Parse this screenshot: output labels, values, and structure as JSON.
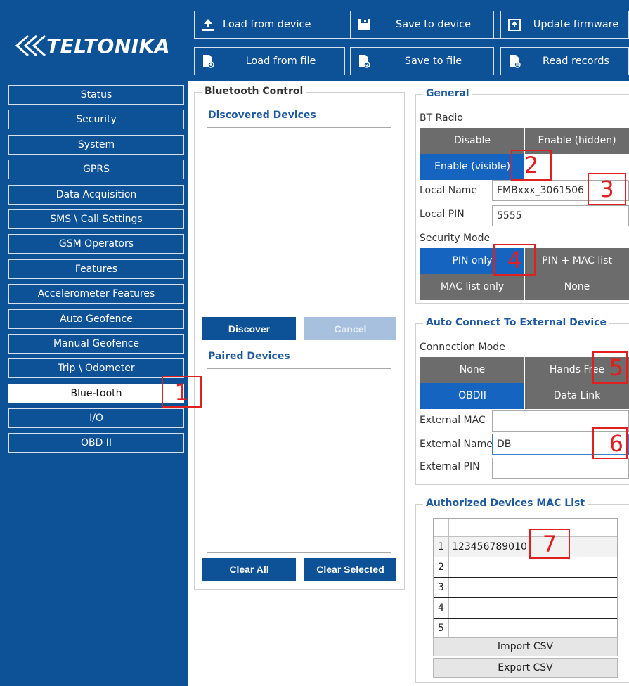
{
  "brand": {
    "name": "TELTONIKA"
  },
  "toolbar": {
    "load_from_device": "Load from device",
    "save_to_device": "Save to device",
    "update_firmware": "Update firmware",
    "load_from_file": "Load from file",
    "save_to_file": "Save to file",
    "read_records": "Read records"
  },
  "sidebar": {
    "items": [
      {
        "label": "Status"
      },
      {
        "label": "Security"
      },
      {
        "label": "System"
      },
      {
        "label": "GPRS"
      },
      {
        "label": "Data Acquisition"
      },
      {
        "label": "SMS \\ Call Settings"
      },
      {
        "label": "GSM Operators"
      },
      {
        "label": "Features"
      },
      {
        "label": "Accelerometer Features"
      },
      {
        "label": "Auto Geofence"
      },
      {
        "label": "Manual Geofence"
      },
      {
        "label": "Trip \\ Odometer"
      },
      {
        "label": "Blue-tooth"
      },
      {
        "label": "I/O"
      },
      {
        "label": "OBD II"
      }
    ],
    "active": "Blue-tooth"
  },
  "bluetooth_control": {
    "title": "Bluetooth Control",
    "discovered_title": "Discovered Devices",
    "discover_btn": "Discover",
    "cancel_btn": "Cancel",
    "paired_title": "Paired Devices",
    "clear_all_btn": "Clear All",
    "clear_selected_btn": "Clear Selected"
  },
  "general": {
    "title": "General",
    "bt_radio_label": "BT Radio",
    "bt_radio_options": [
      "Disable",
      "Enable (hidden)",
      "Enable (visible)"
    ],
    "bt_radio_selected": "Enable (visible)",
    "local_name_label": "Local Name",
    "local_name_value": "FMBxxx_3061506",
    "local_pin_label": "Local PIN",
    "local_pin_value": "5555",
    "security_mode_label": "Security Mode",
    "security_options": [
      "PIN only",
      "PIN + MAC list",
      "MAC list only",
      "None"
    ],
    "security_selected": "PIN only"
  },
  "auto_connect": {
    "title": "Auto Connect To External Device",
    "connection_mode_label": "Connection Mode",
    "mode_options": [
      "None",
      "Hands Free",
      "OBDII",
      "Data Link"
    ],
    "mode_selected": "OBDII",
    "external_mac_label": "External MAC",
    "external_mac_value": "",
    "external_name_label": "External Name",
    "external_name_value": "DB",
    "external_pin_label": "External PIN",
    "external_pin_value": ""
  },
  "mac_list": {
    "title": "Authorized Devices MAC List",
    "rows": [
      {
        "num": "1",
        "value": "123456789010"
      },
      {
        "num": "2",
        "value": ""
      },
      {
        "num": "3",
        "value": ""
      },
      {
        "num": "4",
        "value": ""
      },
      {
        "num": "5",
        "value": ""
      }
    ],
    "import_csv": "Import CSV",
    "export_csv": "Export CSV"
  },
  "annotations": [
    "1",
    "2",
    "3",
    "4",
    "5",
    "6",
    "7"
  ],
  "colors": {
    "primary": "#0d5196",
    "selected": "#1565c0",
    "segment_gray": "#6c6c6c",
    "annotation_red": "#e02020"
  }
}
